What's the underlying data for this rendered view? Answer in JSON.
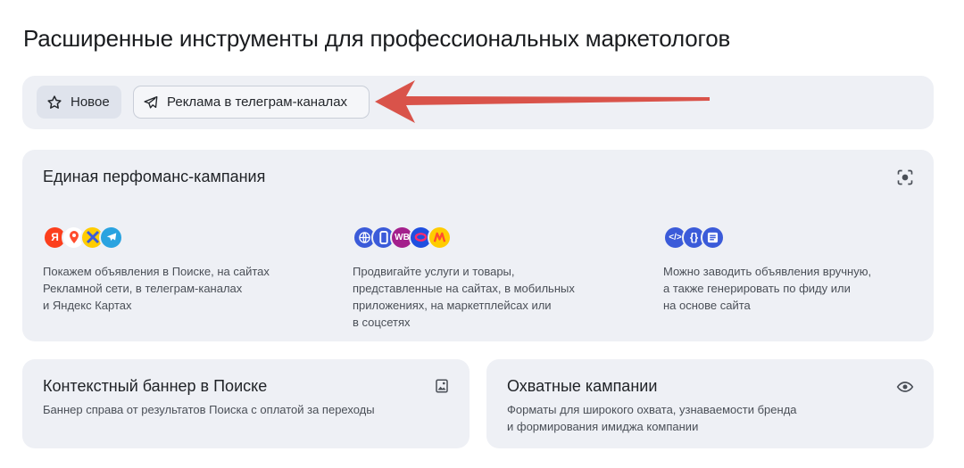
{
  "page": {
    "title": "Расширенные инструменты для профессиональных маркетологов"
  },
  "filters": [
    {
      "label": "Новое",
      "icon": "star-icon"
    },
    {
      "label": "Реклама в телеграм-каналах",
      "icon": "telegram-send-icon"
    }
  ],
  "annotation": {
    "arrow_color": "#d9534a"
  },
  "cards": {
    "performance": {
      "title": "Единая перфоманс-кампания",
      "icon": "scan-icon",
      "columns": [
        {
          "icons": [
            "yandex-icon",
            "maps-pin-icon",
            "yandex-rsya-icon",
            "telegram-icon"
          ],
          "text": "Покажем объявления в Поиске, на сайтах\nРекламной сети, в телеграм-каналах\nи Яндекс Картах"
        },
        {
          "icons": [
            "globe-icon",
            "mobile-app-icon",
            "wildberries-icon",
            "ozon-icon",
            "yandex-market-icon"
          ],
          "text": "Продвигайте услуги и товары,\nпредставленные на сайтах, в мобильных\nприложениях, на маркетплейсах или\nв соцсетях"
        },
        {
          "icons": [
            "code-icon",
            "braces-icon",
            "list-icon"
          ],
          "text": "Можно заводить объявления вручную,\nа также генерировать по фиду или\nна основе сайта"
        }
      ]
    },
    "banner": {
      "title": "Контекстный баннер в Поиске",
      "subtitle": "Баннер справа от результатов Поиска с оплатой за переходы",
      "icon": "image-icon"
    },
    "reach": {
      "title": "Охватные кампании",
      "subtitle": "Форматы для широкого охвата, узнаваемости бренда\nи формирования имиджа компании",
      "icon": "eye-icon"
    }
  },
  "colors": {
    "accent_blue": "#3b5bd9",
    "wildberries": "#a4208c",
    "ozon": "#1f4fe0",
    "yandex_red": "#fc3f1d",
    "market_yellow": "#ffcc00",
    "telegram": "#2aa3e0"
  }
}
